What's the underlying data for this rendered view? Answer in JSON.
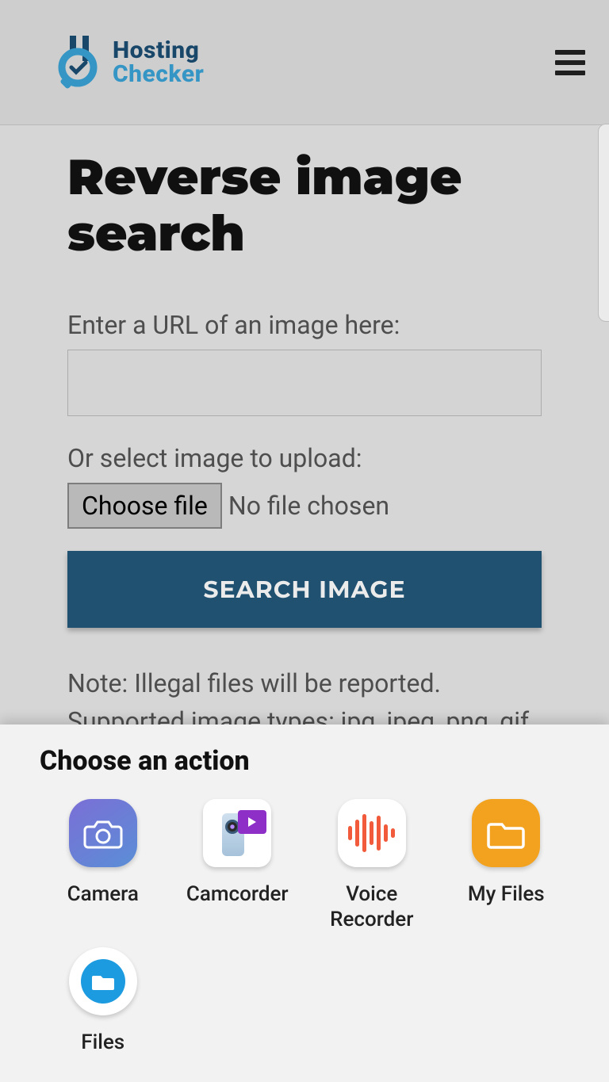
{
  "header": {
    "logo_top": "Hosting",
    "logo_bottom": "Checker"
  },
  "main": {
    "title": "Reverse image search",
    "url_label": "Enter a URL of an image here:",
    "upload_label": "Or select image to upload:",
    "choose_file_label": "Choose file",
    "no_file_text": "No file chosen",
    "search_button": "SEARCH IMAGE",
    "note_line1": "Note: Illegal files will be reported.",
    "note_line2": "Supported image types: jpg, jpeg, png, gif"
  },
  "sheet": {
    "title": "Choose an action",
    "actions": [
      {
        "label": "Camera"
      },
      {
        "label": "Camcorder"
      },
      {
        "label": "Voice Recorder"
      },
      {
        "label": "My Files"
      },
      {
        "label": "Files"
      }
    ]
  }
}
